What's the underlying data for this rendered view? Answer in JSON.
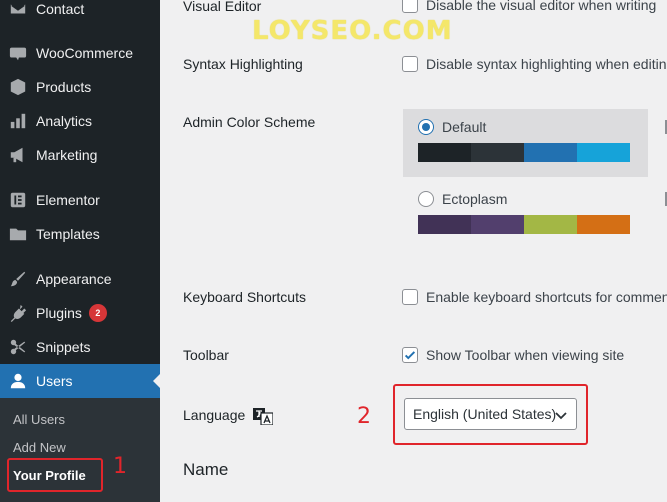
{
  "sidebar": {
    "items": [
      {
        "label": "Contact",
        "icon": "mail-icon"
      },
      {
        "label": "WooCommerce",
        "icon": "woocommerce-icon"
      },
      {
        "label": "Products",
        "icon": "box-icon"
      },
      {
        "label": "Analytics",
        "icon": "bar-chart-icon"
      },
      {
        "label": "Marketing",
        "icon": "megaphone-icon"
      },
      {
        "label": "Elementor",
        "icon": "elementor-icon"
      },
      {
        "label": "Templates",
        "icon": "folder-icon"
      },
      {
        "label": "Appearance",
        "icon": "paintbrush-icon"
      },
      {
        "label": "Plugins",
        "icon": "plug-icon",
        "badge": "2"
      },
      {
        "label": "Snippets",
        "icon": "scissors-icon"
      },
      {
        "label": "Users",
        "icon": "user-icon"
      }
    ],
    "submenu": {
      "all_users": "All Users",
      "add_new": "Add New",
      "your_profile": "Your Profile"
    }
  },
  "content": {
    "visual_editor": {
      "label": "Visual Editor",
      "option": "Disable the visual editor when writing"
    },
    "syntax": {
      "label": "Syntax Highlighting",
      "option": "Disable syntax highlighting when editing code"
    },
    "color_scheme": {
      "label": "Admin Color Scheme",
      "schemes": [
        {
          "name": "Default",
          "selected": true,
          "colors": [
            "#1d2327",
            "#2c3338",
            "#2271b1",
            "#72aee6"
          ]
        },
        {
          "name": "Ectoplasm",
          "selected": false,
          "colors": [
            "#413256",
            "#523f6d",
            "#a3b745",
            "#d46f15"
          ]
        }
      ]
    },
    "keyboard": {
      "label": "Keyboard Shortcuts",
      "option": "Enable keyboard shortcuts for comment moderation"
    },
    "toolbar": {
      "label": "Toolbar",
      "option": "Show Toolbar when viewing site",
      "checked": true
    },
    "language": {
      "label": "Language",
      "value": "English (United States)"
    },
    "name_heading": "Name"
  },
  "annotations": {
    "watermark": "LOYSEO.COM",
    "marker_1": "1",
    "marker_2": "2",
    "color": "#e0252b"
  },
  "colors": {
    "sidebar_bg": "#1d2327",
    "submenu_bg": "#2c3338",
    "accent": "#2271b1",
    "badge": "#d63638"
  }
}
